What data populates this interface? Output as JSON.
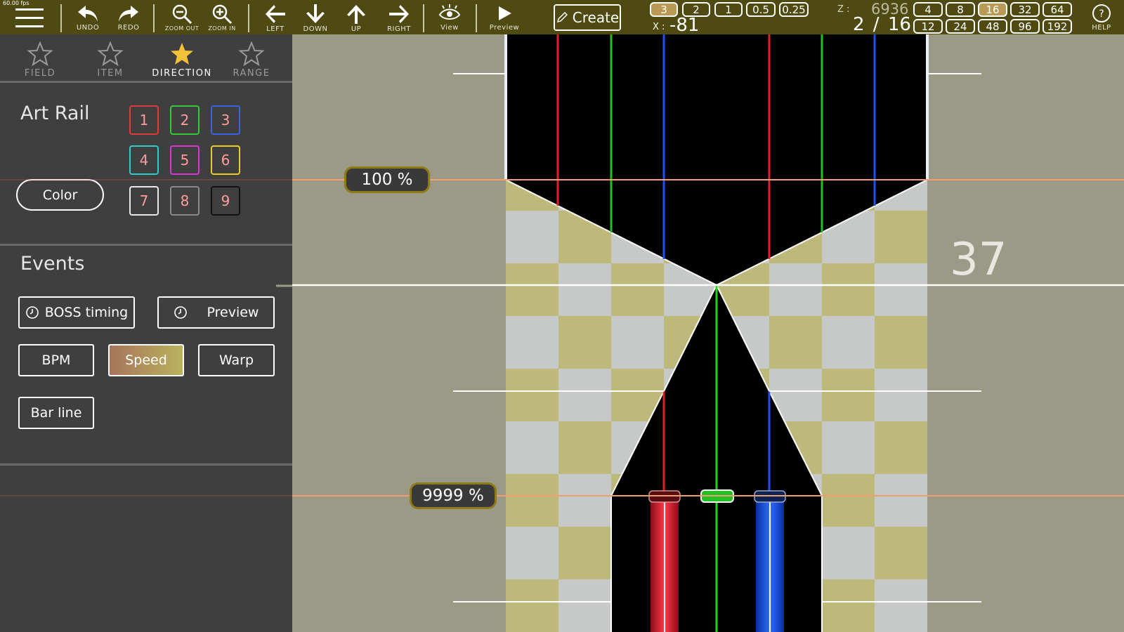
{
  "fps": "60.00 fps",
  "toolbar": {
    "undo": "UNDO",
    "redo": "REDO",
    "zoom_out": "ZOOM OUT",
    "zoom_in": "ZOOM IN",
    "left": "LEFT",
    "down": "DOWN",
    "up": "UP",
    "right": "RIGHT",
    "view": "View",
    "preview": "Preview",
    "create": "Create",
    "help": "HELP",
    "divisions": [
      {
        "label": "3",
        "selected": true
      },
      {
        "label": "2",
        "selected": false
      },
      {
        "label": "1",
        "selected": false
      },
      {
        "label": "0.5",
        "selected": false
      },
      {
        "label": "0.25",
        "selected": false
      }
    ],
    "z_label": "Z :",
    "z_value": "6936",
    "x_label": "X :",
    "x_value": "-81",
    "fraction": "2 / 16",
    "beat_snaps_top": [
      {
        "label": "4",
        "selected": false
      },
      {
        "label": "8",
        "selected": false
      },
      {
        "label": "16",
        "selected": true
      },
      {
        "label": "32",
        "selected": false
      },
      {
        "label": "64",
        "selected": false
      }
    ],
    "beat_snaps_bottom": [
      {
        "label": "12",
        "selected": false
      },
      {
        "label": "24",
        "selected": false
      },
      {
        "label": "48",
        "selected": false
      },
      {
        "label": "96",
        "selected": false
      },
      {
        "label": "192",
        "selected": false
      }
    ]
  },
  "panel": {
    "tabs": [
      {
        "label": "FIELD",
        "active": false
      },
      {
        "label": "ITEM",
        "active": false
      },
      {
        "label": "DIRECTION",
        "active": true
      },
      {
        "label": "RANGE",
        "active": false
      }
    ],
    "art_rail_title": "Art Rail",
    "color_button": "Color",
    "rails": [
      {
        "label": "1",
        "color": "#e03a3a"
      },
      {
        "label": "2",
        "color": "#36c93a"
      },
      {
        "label": "3",
        "color": "#3a63e8"
      },
      {
        "label": "4",
        "color": "#2ccfc3"
      },
      {
        "label": "5",
        "color": "#d23ad2"
      },
      {
        "label": "6",
        "color": "#e6d020"
      },
      {
        "label": "7",
        "color": "#e8e8e8"
      },
      {
        "label": "8",
        "color": "#8a8a8a"
      },
      {
        "label": "9",
        "color": "#111111"
      }
    ],
    "events_title": "Events",
    "events": {
      "boss_timing": "BOSS timing",
      "preview": "Preview",
      "bpm": "BPM",
      "speed": "Speed",
      "warp": "Warp",
      "bar_line": "Bar line"
    }
  },
  "field": {
    "pct_top": "100 %",
    "pct_bottom": "9999 %",
    "measure_number": "37"
  }
}
